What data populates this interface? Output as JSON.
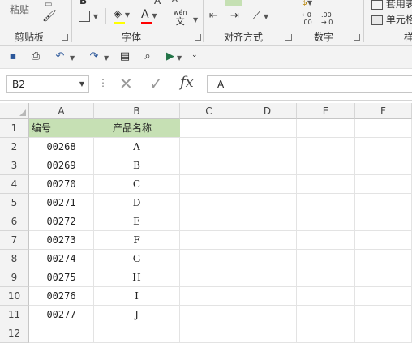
{
  "ribbon": {
    "paste_label": "粘贴",
    "clipboard_label": "剪贴板",
    "font_label": "字体",
    "alignment_label": "对齐方式",
    "number_label": "数字",
    "table_format_label": "套用表",
    "cell_style_label": "单元格",
    "styles_label_partial": "样",
    "wen_label": "wén",
    "wen_char": "文",
    "font_color_letter": "A",
    "font_color": "#ff0000",
    "fill_color": "#ffff00",
    "bold_letter": "B",
    "decimal_inc": "+.0\n.00",
    "decimal_dec": ".00\n→.0"
  },
  "name_box": {
    "value": "B2"
  },
  "formula_bar": {
    "fx_label": "fx",
    "value": "A"
  },
  "columns": [
    "A",
    "B",
    "C",
    "D",
    "E",
    "F"
  ],
  "rows": [
    "1",
    "2",
    "3",
    "4",
    "5",
    "6",
    "7",
    "8",
    "9",
    "10",
    "11",
    "12"
  ],
  "sheet": {
    "header": [
      "编号",
      "产品名称"
    ],
    "data": [
      [
        "00268",
        "A"
      ],
      [
        "00269",
        "B"
      ],
      [
        "00270",
        "C"
      ],
      [
        "00271",
        "D"
      ],
      [
        "00272",
        "E"
      ],
      [
        "00273",
        "F"
      ],
      [
        "00274",
        "G"
      ],
      [
        "00275",
        "H"
      ],
      [
        "00276",
        "I"
      ],
      [
        "00277",
        "J"
      ]
    ]
  },
  "colors": {
    "header_fill": "#c6e0b4",
    "accent": "#217346"
  }
}
